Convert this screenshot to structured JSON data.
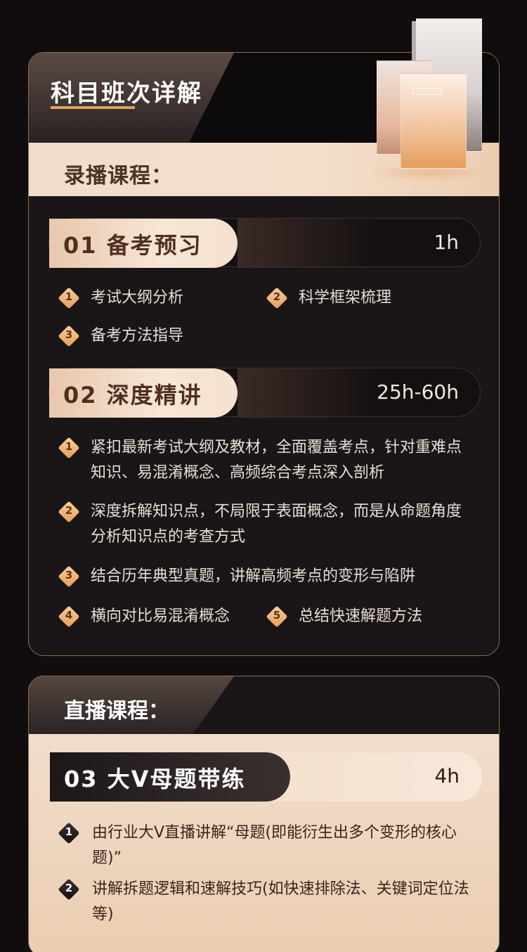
{
  "header": {
    "title": "科目班次详解"
  },
  "recorded": {
    "label": "录播课程：",
    "modules": [
      {
        "tag": "01  备考预习",
        "hours": "1h",
        "items": [
          "考试大纲分析",
          "科学框架梳理",
          "备考方法指导"
        ]
      },
      {
        "tag": "02  深度精讲",
        "hours": "25h-60h",
        "items": [
          "紧扣最新考试大纲及教材，全面覆盖考点，针对重难点知识、易混淆概念、高频综合考点深入剖析",
          "深度拆解知识点，不局限于表面概念，而是从命题角度分析知识点的考查方式",
          "结合历年典型真题，讲解高频考点的变形与陷阱",
          "横向对比易混淆概念",
          "总结快速解题方法"
        ]
      }
    ]
  },
  "live": {
    "label": "直播课程：",
    "module": {
      "tag": "03  大V母题带练",
      "hours": "4h",
      "items": [
        "由行业大V直播讲解“母题(即能衍生出多个变形的核心题)”",
        "讲解拆题逻辑和速解技巧(如快速排除法、关键词定位法等)"
      ]
    }
  },
  "numbers": [
    "1",
    "2",
    "3",
    "4",
    "5"
  ],
  "colors": {
    "accent": "#e2a25c",
    "dark": "#1a1516",
    "cream": "#f3e1d2"
  }
}
